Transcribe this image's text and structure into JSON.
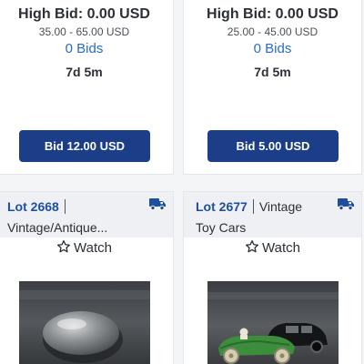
{
  "cards_top": [
    {
      "high_bid": "High Bid: 0.00 USD",
      "range": "35.00 - 65.00 USD",
      "bids": "0 Bids",
      "time_left": "7d 5m",
      "bid_button": "Bid 12.00 USD"
    },
    {
      "high_bid": "High Bid: 0.00 USD",
      "range": "25.00 - 45.00 USD",
      "bids": "0 Bids",
      "time_left": "7d 5m",
      "bid_button": "Bid 5.00 USD"
    }
  ],
  "cards_bottom": [
    {
      "lot": "Lot 2668",
      "category": "",
      "title": "Vintage/Antique...",
      "watch": "Watch",
      "shipping_icon": "truck-icon",
      "photo": "silver round tin box"
    },
    {
      "lot": "Lot 2677",
      "category": "Vintage",
      "title": "Toy Cars",
      "watch": "Watch",
      "shipping_icon": "truck-icon",
      "photo": "green race car and black toy car"
    }
  ],
  "colors": {
    "button_bg": "#1c3d87",
    "lot_link": "#1f4e9c",
    "bids_link": "#2b6cc4"
  }
}
